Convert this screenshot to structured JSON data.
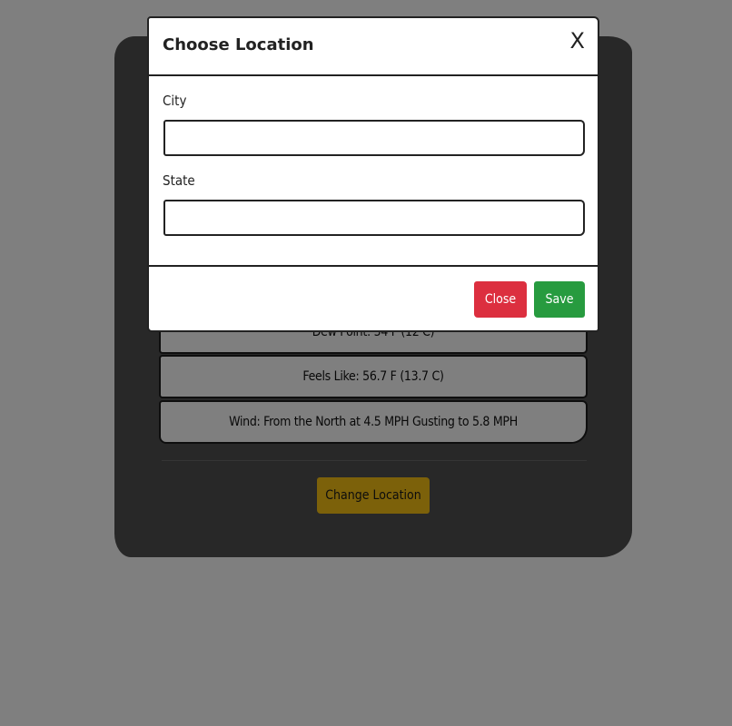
{
  "weather_card": {
    "stats": [
      {
        "label": "Dew Point: 54 F (12 C)"
      },
      {
        "label": "Feels Like: 56.7 F (13.7 C)"
      },
      {
        "label": "Wind: From the North at 4.5 MPH Gusting to 5.8 MPH"
      }
    ],
    "change_location_label": "Change Location"
  },
  "modal": {
    "title": "Choose Location",
    "close_icon": "X",
    "fields": {
      "city": {
        "label": "City",
        "value": "",
        "placeholder": ""
      },
      "state": {
        "label": "State",
        "value": "",
        "placeholder": ""
      }
    },
    "footer": {
      "close_label": "Close",
      "save_label": "Save"
    }
  },
  "colors": {
    "backdrop": "#808080",
    "card_background": "#515151",
    "change_location_button": "#f9c214",
    "close_button": "#dc2f3f",
    "save_button": "#279b3f"
  }
}
